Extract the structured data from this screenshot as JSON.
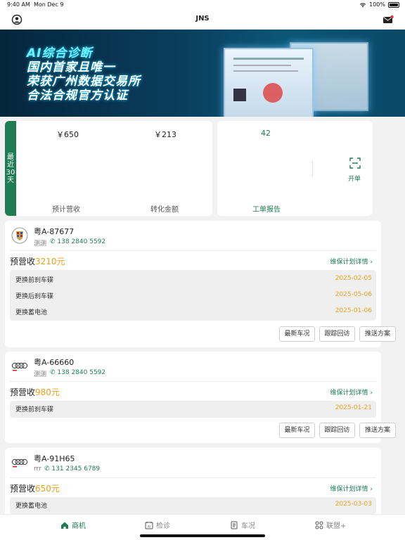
{
  "status_bar": {
    "time": "9:40 AM",
    "date": "Mon Dec 9",
    "battery": "100%"
  },
  "nav": {
    "title": "JNS"
  },
  "banner": {
    "lines": [
      "AI综合诊断",
      "国内首家且唯一",
      "荣获广州数据交易所",
      "合法合规官方认证"
    ]
  },
  "stats": {
    "side_label": "最近30天",
    "estimated_revenue": {
      "value": "￥650",
      "label": "预计营收"
    },
    "conversion_amount": {
      "value": "￥213",
      "label": "转化金额"
    },
    "work_orders": {
      "value": "42",
      "label": "工单报告"
    },
    "open_order": {
      "label": "开单"
    }
  },
  "vehicles": [
    {
      "plate": "粤A-87677",
      "owner": "测测",
      "phone": "138 2840 5592",
      "revenue_label": "预营收",
      "revenue_amount": "3210元",
      "plan_link": "维保计划详情",
      "items": [
        {
          "name": "更换前刹车碟",
          "date": "2025-02-05"
        },
        {
          "name": "更换后刹车碟",
          "date": "2025-05-06"
        },
        {
          "name": "更换蓄电池",
          "date": "2025-01-06"
        }
      ],
      "buttons": [
        "最新车况",
        "跟踪回访",
        "推送方案"
      ]
    },
    {
      "plate": "粤A-66660",
      "owner": "测测",
      "phone": "138 2840 5592",
      "revenue_label": "预营收",
      "revenue_amount": "980元",
      "plan_link": "维保计划详情",
      "items": [
        {
          "name": "更换前刹车碟",
          "date": "2025-01-21"
        }
      ],
      "buttons": [
        "最新车况",
        "跟踪回访",
        "推送方案"
      ]
    },
    {
      "plate": "粤A-91H65",
      "owner": "rrr",
      "phone": "131 2345 6789",
      "revenue_label": "预营收",
      "revenue_amount": "650元",
      "plan_link": "维保计划详情",
      "items": [
        {
          "name": "更换蓄电池",
          "date": "2025-03-03"
        }
      ]
    }
  ],
  "tabbar": {
    "tabs": [
      "商机",
      "检诊",
      "车况",
      "联盟+"
    ],
    "active": "商机"
  },
  "colors": {
    "accent": "#1e7d55",
    "amount": "#e8a21c",
    "background": "#f2f2f2"
  }
}
